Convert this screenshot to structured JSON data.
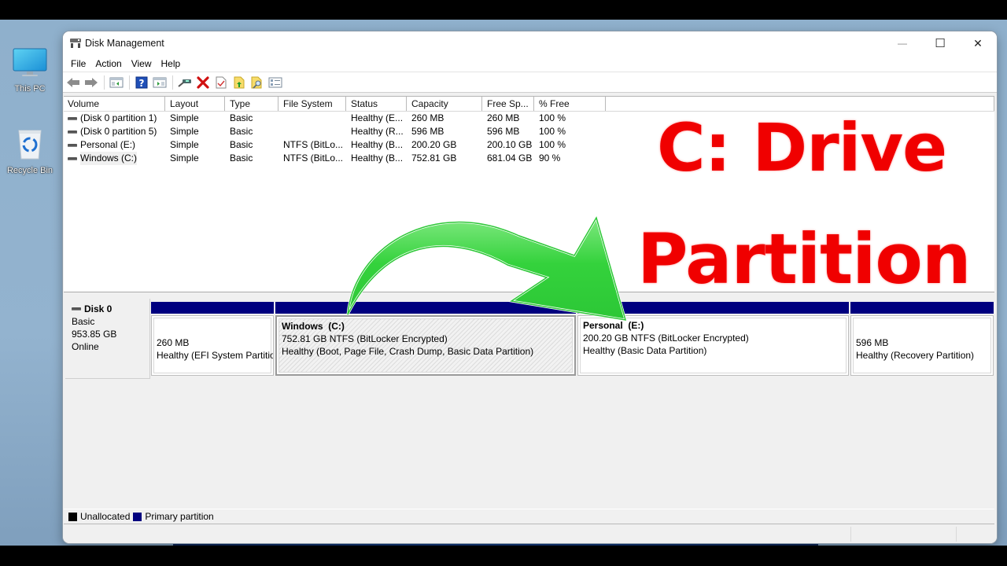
{
  "desktop": {
    "icons": [
      {
        "label": "This PC",
        "icon": "monitor-icon"
      },
      {
        "label": "Recycle Bin",
        "icon": "recycle-bin-icon"
      }
    ]
  },
  "window": {
    "title": "Disk Management",
    "controls": {
      "minimize": "—",
      "maximize": "☐",
      "close": "✕"
    }
  },
  "menubar": {
    "items": [
      "File",
      "Action",
      "View",
      "Help"
    ]
  },
  "toolbar": {
    "buttons": [
      "back-icon",
      "forward-icon",
      "show-hide-console-tree-icon",
      "help-icon",
      "show-hide-action-pane-icon",
      "connect-drive-icon",
      "delete-icon",
      "properties-check-icon",
      "open-folder-up-icon",
      "explore-folder-icon",
      "details-list-icon"
    ]
  },
  "volume_list": {
    "columns": [
      "Volume",
      "Layout",
      "Type",
      "File System",
      "Status",
      "Capacity",
      "Free Sp...",
      "% Free"
    ],
    "rows": [
      {
        "volume": "(Disk 0 partition 1)",
        "layout": "Simple",
        "type": "Basic",
        "fs": "",
        "status": "Healthy (E...",
        "capacity": "260 MB",
        "free": "260 MB",
        "pct": "100 %"
      },
      {
        "volume": "(Disk 0 partition 5)",
        "layout": "Simple",
        "type": "Basic",
        "fs": "",
        "status": "Healthy (R...",
        "capacity": "596 MB",
        "free": "596 MB",
        "pct": "100 %"
      },
      {
        "volume": "Personal (E:)",
        "layout": "Simple",
        "type": "Basic",
        "fs": "NTFS (BitLo...",
        "status": "Healthy (B...",
        "capacity": "200.20 GB",
        "free": "200.10 GB",
        "pct": "100 %"
      },
      {
        "volume": "Windows (C:)",
        "layout": "Simple",
        "type": "Basic",
        "fs": "NTFS (BitLo...",
        "status": "Healthy (B...",
        "capacity": "752.81 GB",
        "free": "681.04 GB",
        "pct": "90 %"
      }
    ]
  },
  "disk": {
    "name": "Disk 0",
    "type": "Basic",
    "size": "953.85 GB",
    "state": "Online",
    "partitions": [
      {
        "name": "",
        "line1": "260 MB",
        "line2": "Healthy (EFI System Partition)",
        "selected": false
      },
      {
        "name": "Windows  (C:)",
        "line1": "752.81 GB NTFS (BitLocker Encrypted)",
        "line2": "Healthy (Boot, Page File, Crash Dump, Basic Data Partition)",
        "selected": true
      },
      {
        "name": "Personal  (E:)",
        "line1": "200.20 GB NTFS (BitLocker Encrypted)",
        "line2": "Healthy (Basic Data Partition)",
        "selected": false
      },
      {
        "name": "",
        "line1": "596 MB",
        "line2": "Healthy (Recovery Partition)",
        "selected": false
      }
    ]
  },
  "legend": {
    "items": [
      {
        "label": "Unallocated",
        "color": "#000000"
      },
      {
        "label": "Primary partition",
        "color": "#00007f"
      }
    ]
  },
  "overlay": {
    "line1": "C: Drive",
    "line2": "Partition",
    "text_color": "#f00000",
    "arrow_color": "#2fd13a"
  }
}
